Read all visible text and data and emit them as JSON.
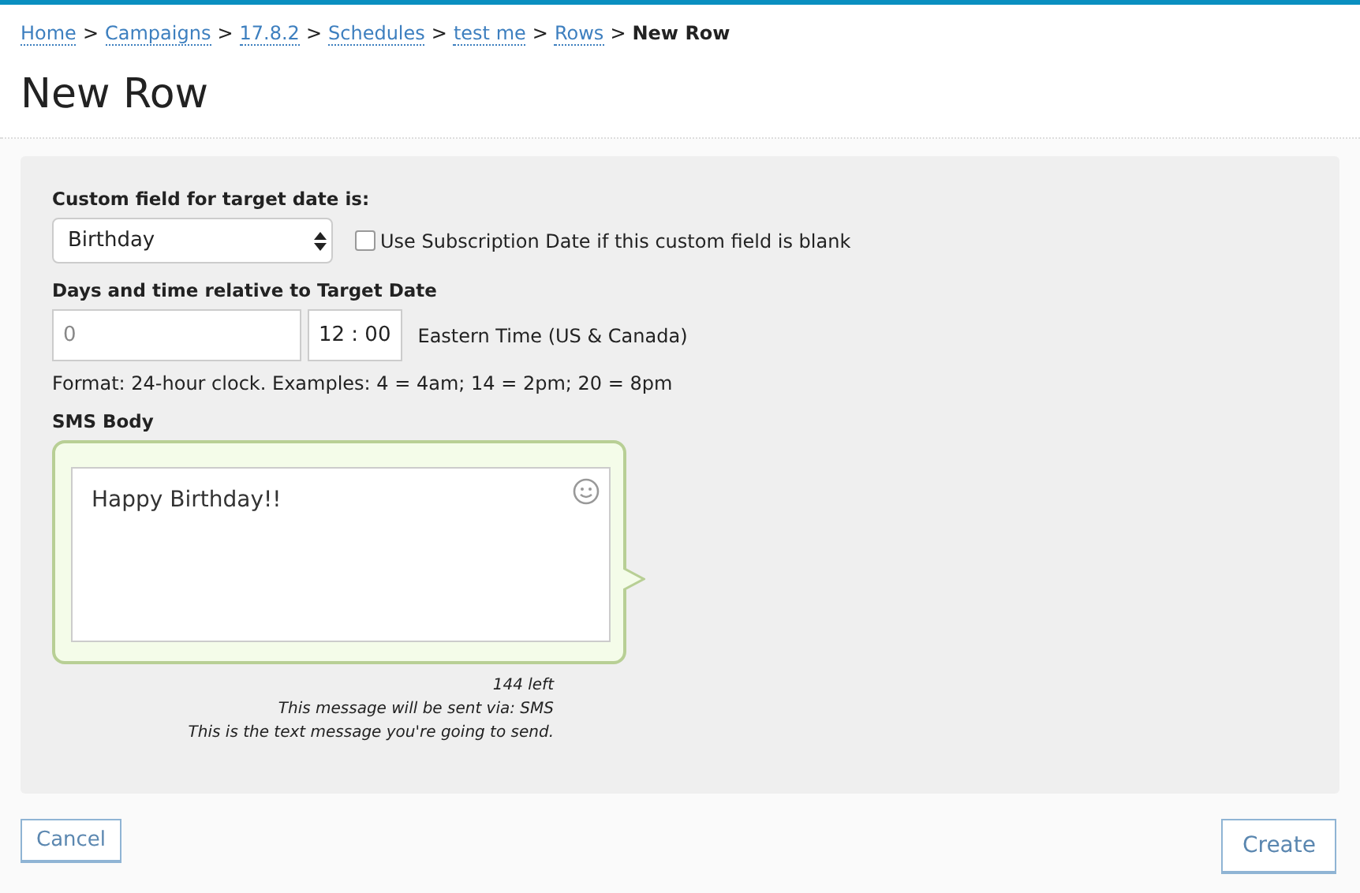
{
  "breadcrumbs": [
    {
      "label": "Home",
      "kind": "link"
    },
    {
      "label": "Campaigns",
      "kind": "link"
    },
    {
      "label": "17.8.2",
      "kind": "link"
    },
    {
      "label": "Schedules",
      "kind": "link"
    },
    {
      "label": "test me",
      "kind": "link"
    },
    {
      "label": "Rows",
      "kind": "link"
    },
    {
      "label": "New Row",
      "kind": "current"
    }
  ],
  "separator": ">",
  "title": "New Row",
  "form": {
    "custom_field_label": "Custom field for target date is:",
    "custom_field_value": "Birthday",
    "fallback": {
      "label": "Use Subscription Date if this custom field is blank",
      "checked": false
    },
    "days_label": "Days and time relative to Target Date",
    "days_placeholder": "0",
    "hour": "12",
    "minute": "00",
    "time_separator": ":",
    "timezone": "Eastern Time (US & Canada)",
    "format_hint": "Format: 24-hour clock. Examples: 4 = 4am; 14 = 2pm; 20 = 8pm",
    "sms_label": "SMS Body",
    "sms_body": "Happy Birthday!!",
    "chars_left": "144 left",
    "sent_via": "This message will be sent via: SMS",
    "note": "This is the text message you're going to send."
  },
  "buttons": {
    "cancel": "Cancel",
    "create": "Create"
  }
}
